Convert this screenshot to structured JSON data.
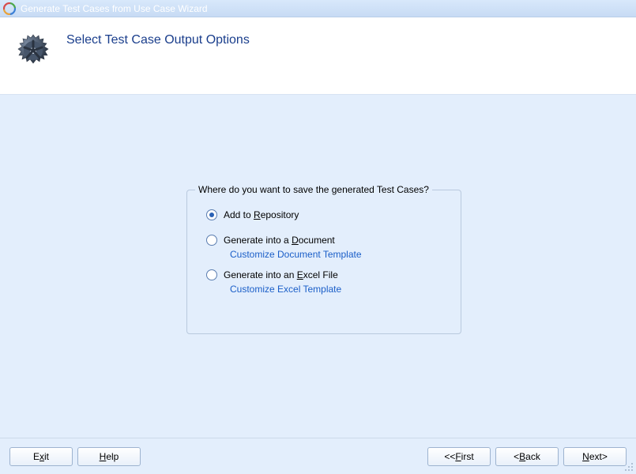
{
  "window": {
    "title": "Generate Test Cases from Use Case Wizard"
  },
  "header": {
    "heading": "Select Test Case Output Options"
  },
  "group": {
    "legend": "Where do you want to save the generated Test Cases?"
  },
  "options": {
    "repository": {
      "pre": "Add to ",
      "mn": "R",
      "post": "epository",
      "selected": true
    },
    "document": {
      "pre": "Generate into a ",
      "mn": "D",
      "post": "ocument",
      "selected": false,
      "link": "Customize Document Template"
    },
    "excel": {
      "pre": "Generate into an ",
      "mn": "E",
      "post": "xcel File",
      "selected": false,
      "link": "Customize Excel Template"
    }
  },
  "footer": {
    "exit": {
      "pre": "E",
      "mn": "x",
      "post": "it"
    },
    "help": {
      "pre": "",
      "mn": "H",
      "post": "elp"
    },
    "first": {
      "prefix": "<<  ",
      "pre": "",
      "mn": "F",
      "post": "irst"
    },
    "back": {
      "prefix": "<  ",
      "pre": "",
      "mn": "B",
      "post": "ack"
    },
    "next": {
      "pre": "",
      "mn": "N",
      "post": "ext",
      "suffix": " >"
    }
  }
}
